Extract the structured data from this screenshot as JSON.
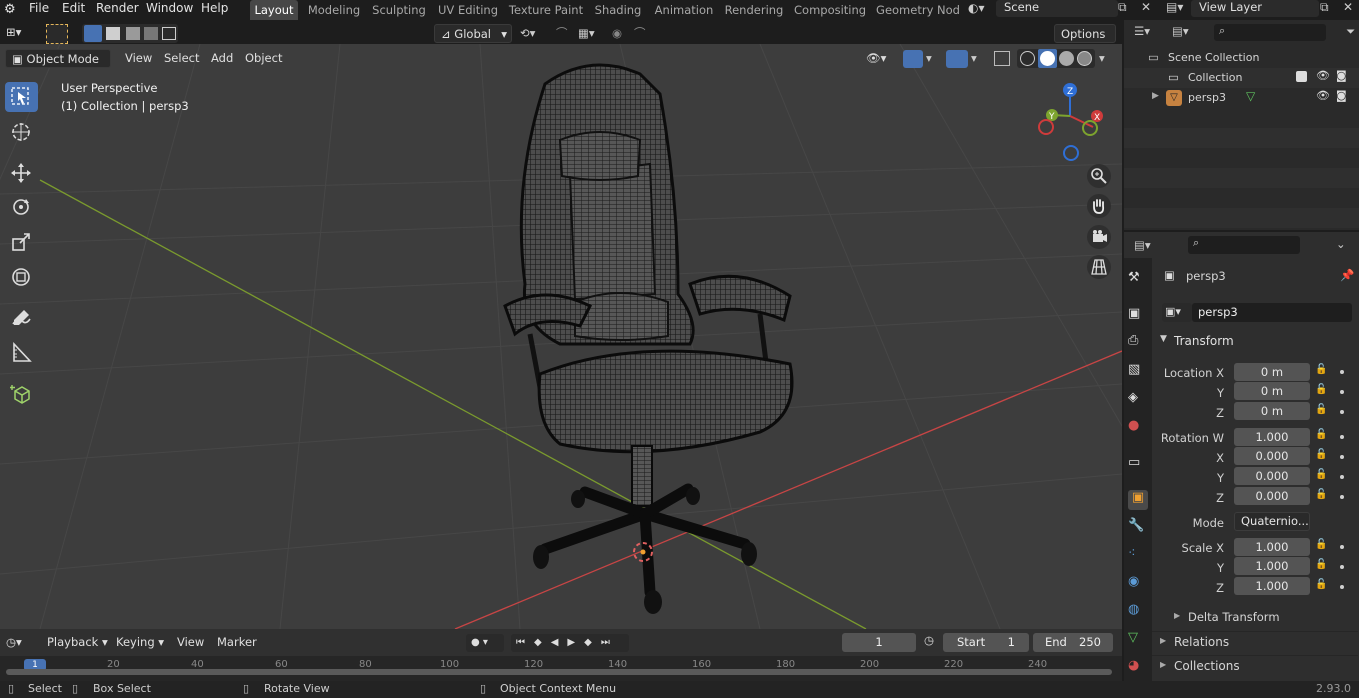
{
  "menu": {
    "items": [
      "File",
      "Edit",
      "Render",
      "Window",
      "Help"
    ]
  },
  "workspaces": {
    "tabs": [
      "Layout",
      "Modeling",
      "Sculpting",
      "UV Editing",
      "Texture Paint",
      "Shading",
      "Animation",
      "Rendering",
      "Compositing",
      "Geometry Nod"
    ],
    "active": "Layout"
  },
  "scene": {
    "name": "Scene"
  },
  "viewlayer": {
    "name": "View Layer"
  },
  "header": {
    "mode": "Object Mode",
    "view": "View",
    "select": "Select",
    "add": "Add",
    "object": "Object",
    "orientation": "Global",
    "options": "Options"
  },
  "viewport": {
    "perspective": "User Perspective",
    "context": "(1) Collection | persp3"
  },
  "outliner": {
    "root": "Scene Collection",
    "collection": "Collection",
    "object": "persp3"
  },
  "props": {
    "object_name": "persp3",
    "data_name": "persp3",
    "transform_title": "Transform",
    "location_label": "Location X",
    "location": [
      "0 m",
      "0 m",
      "0 m"
    ],
    "rotation_label": "Rotation W",
    "rotation": [
      "1.000",
      "0.000",
      "0.000",
      "0.000"
    ],
    "axis_y": "Y",
    "axis_z": "Z",
    "axis_x": "X",
    "mode_label": "Mode",
    "mode_value": "Quaternio...",
    "scale_label": "Scale X",
    "scale": [
      "1.000",
      "1.000",
      "1.000"
    ],
    "delta": "Delta Transform",
    "relations": "Relations",
    "collections": "Collections"
  },
  "timeline": {
    "playback": "Playback",
    "keying": "Keying",
    "view": "View",
    "marker": "Marker",
    "current_frame": "1",
    "start_label": "Start",
    "start": "1",
    "end_label": "End",
    "end": "250",
    "ticks": [
      "1",
      "20",
      "40",
      "60",
      "80",
      "100",
      "120",
      "140",
      "160",
      "180",
      "200",
      "220",
      "240"
    ]
  },
  "status": {
    "select": "Select",
    "box_select": "Box Select",
    "rotate_view": "Rotate View",
    "context_menu": "Object Context Menu",
    "version": "2.93.0"
  },
  "colors": {
    "accent": "#4772b3",
    "viewport_bg": "#3d3d3d",
    "axis_x": "#d04a4a",
    "axis_y": "#7a9a2e"
  }
}
